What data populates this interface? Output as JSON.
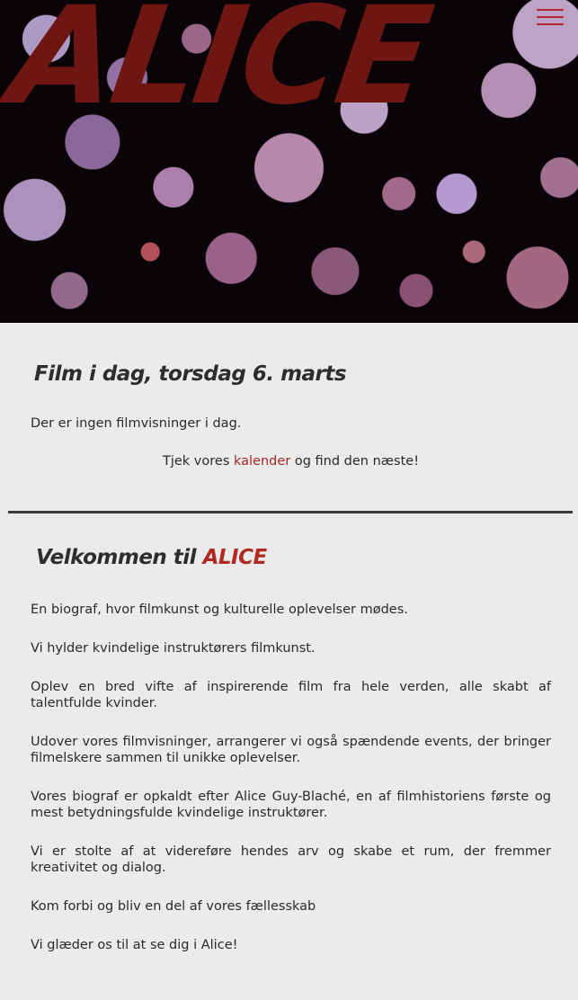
{
  "hero": {
    "title": "ALICE",
    "menu_icon": "hamburger-menu-icon"
  },
  "today": {
    "heading": "Film i dag, torsdag 6. marts",
    "message": "Der er ingen filmvisninger i dag.",
    "cta_prefix": "Tjek vores ",
    "cta_link": "kalender",
    "cta_suffix": " og find den næste!"
  },
  "welcome": {
    "heading_prefix": "Velkommen til ",
    "heading_accent": "ALICE",
    "paragraphs": [
      "En biograf, hvor filmkunst og kulturelle oplevelser mødes.",
      "Vi hylder kvindelige instruktørers filmkunst.",
      "Oplev en bred vifte af inspirerende film fra hele verden, alle skabt af talentfulde kvinder.",
      "Udover vores filmvisninger, arrangerer vi også spændende events, der bringer filmelskere sammen til unikke oplevelser.",
      "Vores biograf er opkaldt efter Alice Guy-Blaché, en af filmhistoriens første og mest betydningsfulde kvindelige instruktører.",
      "Vi er stolte af at videreføre hendes arv og skabe et rum, der fremmer kreativitet og dialog.",
      "Kom forbi og bliv en del af vores fællesskab",
      "Vi glæder os til at se dig i Alice!"
    ]
  },
  "colors": {
    "brand": "#6e1612",
    "accent": "#b02a22",
    "background": "#ebebeb",
    "text": "#2a2a2a"
  }
}
